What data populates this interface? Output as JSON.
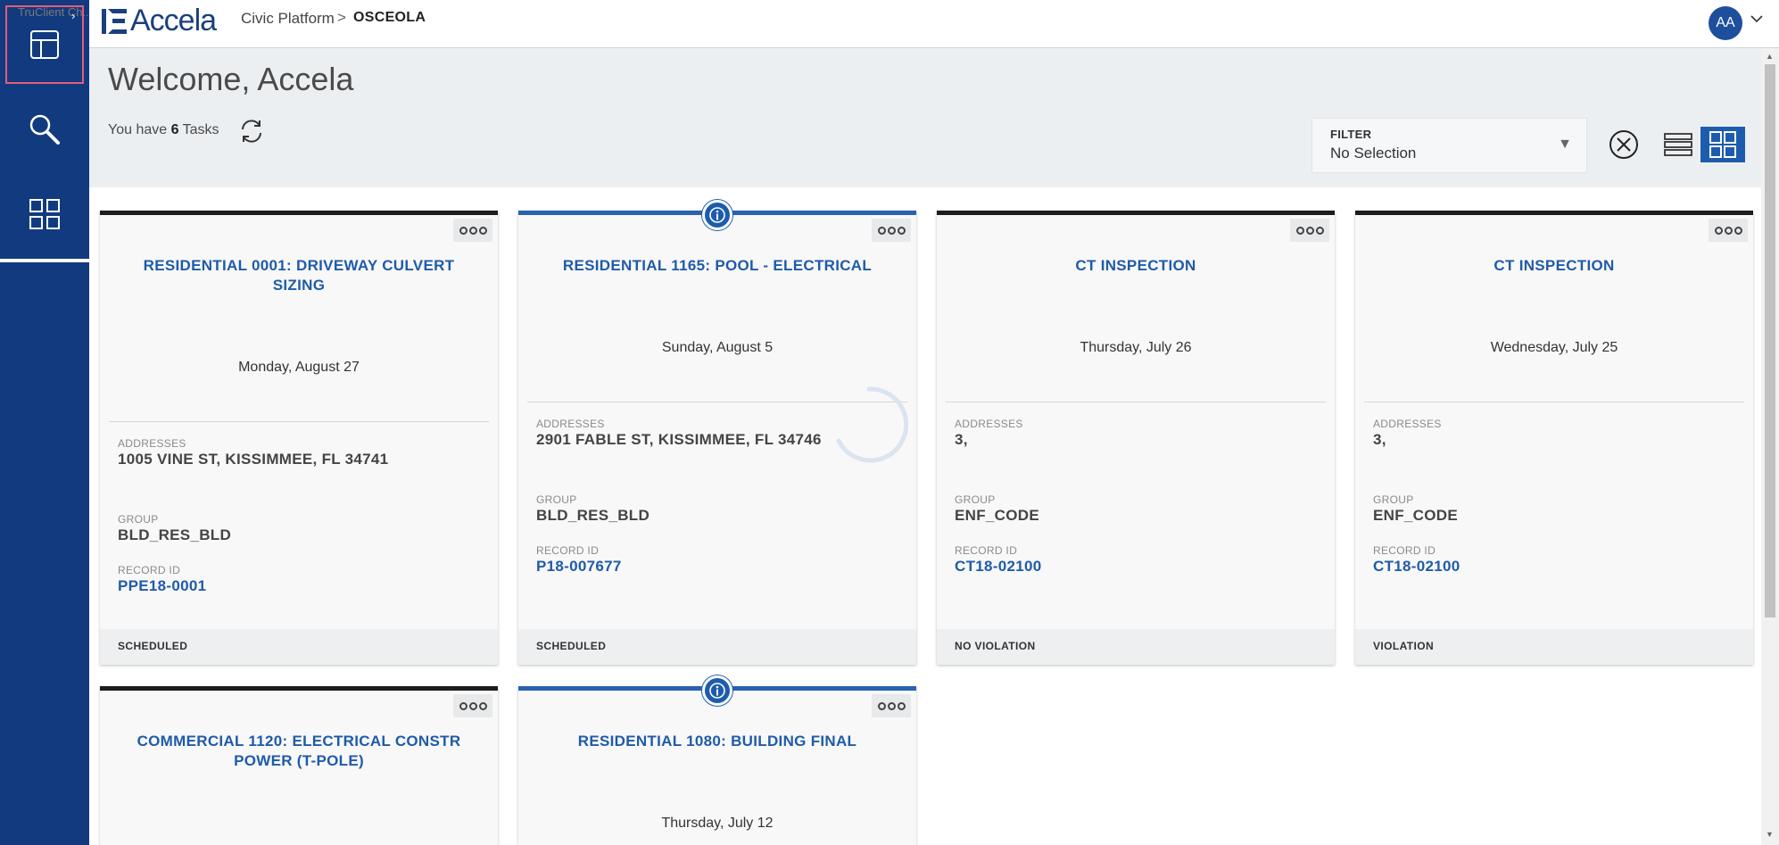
{
  "overlay": {
    "tiny_text": "TruClient Ch... ine"
  },
  "header": {
    "logo_text": "Accela",
    "breadcrumb_app": "Civic Platform",
    "breadcrumb_sep": ">",
    "breadcrumb_current": "OSCEOLA",
    "avatar_initials": "AA"
  },
  "sidebar": {
    "items": [
      {
        "icon": "dashboard-icon",
        "active": true
      },
      {
        "icon": "search-icon"
      },
      {
        "icon": "apps-grid-icon"
      }
    ]
  },
  "main": {
    "welcome": "Welcome, Accela",
    "tasks_prefix": "You have ",
    "tasks_count": "6",
    "tasks_suffix": " Tasks",
    "filter_label": "FILTER",
    "filter_value": "No Selection"
  },
  "labels": {
    "addresses": "ADDRESSES",
    "group": "GROUP",
    "record_id": "RECORD ID"
  },
  "cards": [
    {
      "title_line1": "RESIDENTIAL 0001: DRIVEWAY CULVERT",
      "title_line2": "SIZING",
      "date": "Monday, August 27",
      "address": "1005 VINE ST, KISSIMMEE, FL 34741",
      "group": "BLD_RES_BLD",
      "record_id": "PPE18-0001",
      "status": "SCHEDULED",
      "has_info": false
    },
    {
      "title_line1": "RESIDENTIAL 1165: POOL - ELECTRICAL",
      "title_line2": "",
      "date": "Sunday, August 5",
      "address": "2901 FABLE ST, KISSIMMEE, FL 34746",
      "group": "BLD_RES_BLD",
      "record_id": "P18-007677",
      "status": "SCHEDULED",
      "has_info": true
    },
    {
      "title_line1": "CT INSPECTION",
      "title_line2": "",
      "date": "Thursday, July 26",
      "address": "3,",
      "group": "ENF_CODE",
      "record_id": "CT18-02100",
      "status": "NO VIOLATION",
      "has_info": false
    },
    {
      "title_line1": "CT INSPECTION",
      "title_line2": "",
      "date": "Wednesday, July 25",
      "address": "3,",
      "group": "ENF_CODE",
      "record_id": "CT18-02100",
      "status": "VIOLATION",
      "has_info": false
    },
    {
      "title_line1": "COMMERCIAL 1120: ELECTRICAL CONSTR",
      "title_line2": "POWER (T-POLE)",
      "has_info": false
    },
    {
      "title_line1": "RESIDENTIAL 1080: BUILDING FINAL",
      "title_line2": "",
      "date": "Thursday, July 12",
      "has_info": true
    }
  ],
  "colors": {
    "sidebar_bg": "#123a7e",
    "link_blue": "#1f5ba8",
    "accent_blue": "#1d5cac",
    "card_border_dark": "#1d1d1d"
  }
}
